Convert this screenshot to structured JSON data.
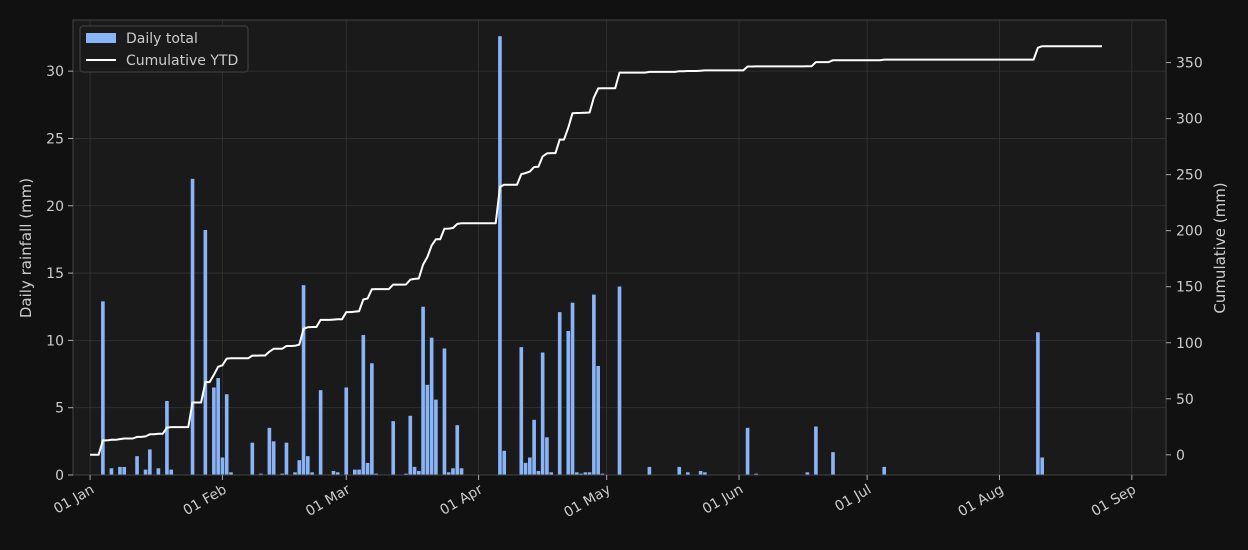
{
  "chart_data": {
    "type": "bar",
    "xlabel": "",
    "ylabel": "Daily rainfall (mm)",
    "y2label": "Cumulative (mm)",
    "ylim": [
      0,
      33.8
    ],
    "y2lim": [
      -18,
      388
    ],
    "xlim": [
      "2024-12-28",
      "2024-09-01"
    ],
    "x_ticks": [
      "01 Jan",
      "01 Feb",
      "01 Mar",
      "01 Apr",
      "01 May",
      "01 Jun",
      "01 Jul",
      "01 Aug",
      "01 Sep"
    ],
    "y_ticks": [
      0,
      5,
      10,
      15,
      20,
      25,
      30
    ],
    "y2_ticks": [
      0,
      50,
      100,
      150,
      200,
      250,
      300,
      350
    ],
    "grid": true,
    "legend_position": "top-left",
    "colors": {
      "background": "#111111",
      "plot": "#1a1a1a",
      "bar": "#8ab4f8",
      "line": "#ffffff",
      "grid": "#333333",
      "text": "#cccccc"
    },
    "series": [
      {
        "name": "Daily total",
        "kind": "bar",
        "x": [
          "01-04",
          "01-06",
          "01-08",
          "01-09",
          "01-12",
          "01-14",
          "01-15",
          "01-17",
          "01-19",
          "01-20",
          "01-25",
          "01-28",
          "01-30",
          "01-31",
          "02-01",
          "02-02",
          "02-03",
          "02-08",
          "02-10",
          "02-12",
          "02-13",
          "02-15",
          "02-16",
          "02-18",
          "02-19",
          "02-20",
          "02-21",
          "02-22",
          "02-24",
          "02-27",
          "02-28",
          "03-01",
          "03-03",
          "03-04",
          "03-05",
          "03-06",
          "03-07",
          "03-08",
          "03-12",
          "03-15",
          "03-16",
          "03-17",
          "03-18",
          "03-19",
          "03-20",
          "03-21",
          "03-22",
          "03-24",
          "03-25",
          "03-26",
          "03-27",
          "03-28",
          "04-06",
          "04-07",
          "04-11",
          "04-12",
          "04-13",
          "04-14",
          "04-15",
          "04-16",
          "04-17",
          "04-18",
          "04-20",
          "04-22",
          "04-23",
          "04-24",
          "04-25",
          "04-26",
          "04-27",
          "04-28",
          "04-29",
          "04-30",
          "05-04",
          "05-11",
          "05-18",
          "05-20",
          "05-23",
          "05-24",
          "06-03",
          "06-05",
          "06-17",
          "06-19",
          "06-23",
          "07-05"
        ],
        "values": [
          12.9,
          0.5,
          0.6,
          0.6,
          1.4,
          0.4,
          1.9,
          0.5,
          5.5,
          0.4,
          22.0,
          18.2,
          6.5,
          7.2,
          1.3,
          6.0,
          0.2,
          2.4,
          0.1,
          3.5,
          2.5,
          0.1,
          2.4,
          0.2,
          1.1,
          14.1,
          1.4,
          0.2,
          6.3,
          0.3,
          0.2,
          6.5,
          0.4,
          0.4,
          10.4,
          0.9,
          8.3,
          0.1,
          4.0,
          0.1,
          4.4,
          0.6,
          0.3,
          12.5,
          6.7,
          10.2,
          5.6,
          9.4,
          0.2,
          0.5,
          3.7,
          0.5,
          32.6,
          1.8,
          9.5,
          0.9,
          1.3,
          4.1,
          0.3,
          9.1,
          2.8,
          0.2,
          12.1,
          10.7,
          12.8,
          0.2,
          0.1,
          0.2,
          0.2,
          13.4,
          8.1,
          0.1,
          14.0,
          0.6,
          0.6,
          0.2,
          0.3,
          0.2,
          3.5,
          0.1,
          0.2,
          3.6,
          1.7,
          0.6
        ],
        "extra": {
          "x": [
            "08-10",
            "08-11"
          ],
          "values": [
            10.6,
            1.3
          ]
        }
      },
      {
        "name": "Cumulative YTD",
        "kind": "line",
        "start": "01-01",
        "end": "08-25",
        "end_value": 372.4
      }
    ]
  },
  "legend": {
    "bar_label": "Daily total",
    "line_label": "Cumulative YTD"
  }
}
